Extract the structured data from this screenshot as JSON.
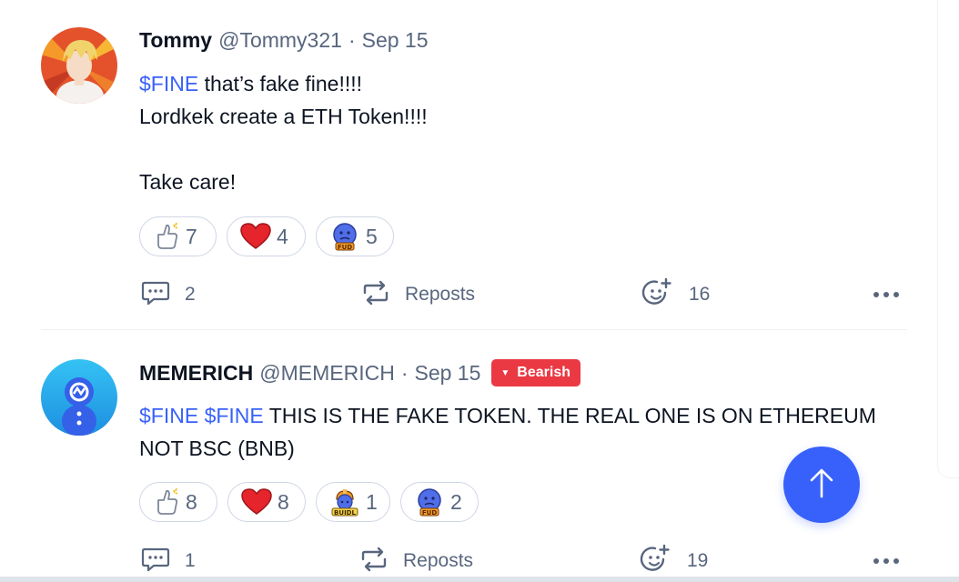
{
  "posts": [
    {
      "author": "Tommy",
      "handle": "@Tommy321",
      "separator": "·",
      "date": "Sep 15",
      "text": {
        "line1_cashtag": "$FINE",
        "line1_rest": " that’s fake fine!!!!",
        "line2": "Lordkek create a ETH Token!!!!",
        "line3": "Take care!"
      },
      "reactions": [
        {
          "icon": "thumbs-up-icon",
          "count": "7"
        },
        {
          "icon": "heart-icon",
          "count": "4"
        },
        {
          "icon": "fud-icon",
          "count": "5"
        }
      ],
      "actions": {
        "comments": "2",
        "repost_label": "Reposts",
        "reactions_total": "16"
      }
    },
    {
      "author": "MEMERICH",
      "handle": "@MEMERICH",
      "separator": "·",
      "date": "Sep 15",
      "badge": "Bearish",
      "text": {
        "cashtag1": "$FINE",
        "cashtag2": "$FINE",
        "line1_rest": " THIS IS THE FAKE TOKEN. THE REAL ONE IS ON ETHEREUM",
        "line2": "NOT BSC (BNB)"
      },
      "reactions": [
        {
          "icon": "thumbs-up-icon",
          "count": "8"
        },
        {
          "icon": "heart-icon",
          "count": "8"
        },
        {
          "icon": "buidl-icon",
          "count": "1"
        },
        {
          "icon": "fud-icon",
          "count": "2"
        }
      ],
      "actions": {
        "comments": "1",
        "repost_label": "Reposts",
        "reactions_total": "19"
      }
    }
  ],
  "colors": {
    "cashtag": "#3861fb",
    "bearish": "#ea3943",
    "muted": "#58667e",
    "scroll_button": "#3861fb"
  }
}
